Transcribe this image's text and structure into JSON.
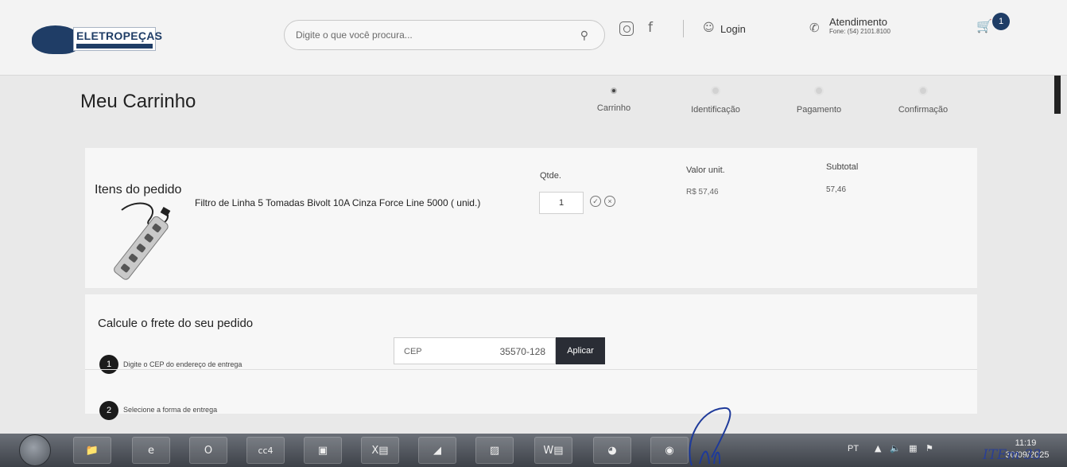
{
  "header": {
    "logo_text": "ELETROPEÇAS",
    "search_placeholder": "Digite o que você procura...",
    "login_label": "Login",
    "atendimento_title": "Atendimento",
    "atendimento_phone": "Fone: (54) 2101.8100",
    "cart_count": "1"
  },
  "page": {
    "title": "Meu Carrinho"
  },
  "steps": [
    {
      "label": "Carrinho",
      "active": true
    },
    {
      "label": "Identificação",
      "active": false
    },
    {
      "label": "Pagamento",
      "active": false
    },
    {
      "label": "Confirmação",
      "active": false
    }
  ],
  "order": {
    "section_title": "Itens do pedido",
    "col_qty": "Qtde.",
    "col_unit": "Valor unit.",
    "col_subtotal": "Subtotal",
    "item": {
      "name": "Filtro de Linha 5 Tomadas Bivolt 10A Cinza Force Line 5000 ( unid.)",
      "qty": "1",
      "unit_price": "R$ 57,46",
      "subtotal": "57,46"
    }
  },
  "shipping": {
    "title": "Calcule o frete do seu pedido",
    "step1_num": "1",
    "step1_text": "Digite o CEP do endereço de entrega",
    "cep_label": "CEP",
    "cep_value": "35570-128",
    "apply_label": "Aplicar",
    "step2_num": "2",
    "step2_text": "Selecione a forma de entrega"
  },
  "taskbar": {
    "lang": "PT",
    "time": "11:19",
    "date": "30/09/2025"
  },
  "annotation": {
    "text": "ITEm 33"
  }
}
